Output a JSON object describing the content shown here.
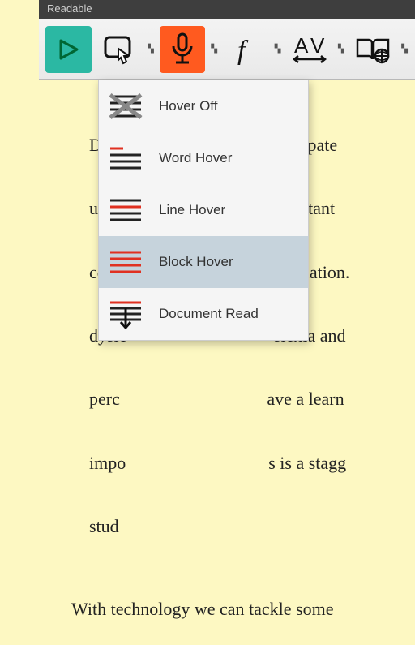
{
  "titlebar": {
    "title": "Readable"
  },
  "toolbar": {
    "buttons": [
      "play",
      "hover",
      "mic",
      "font",
      "spacing",
      "dictionary"
    ]
  },
  "dropdown": {
    "items": [
      {
        "label": "Hover Off",
        "icon": "lines-crossed"
      },
      {
        "label": "Word Hover",
        "icon": "lines-top-red"
      },
      {
        "label": "Line Hover",
        "icon": "lines-mid-red"
      },
      {
        "label": "Block Hover",
        "icon": "lines-all-red",
        "selected": true
      },
      {
        "label": "Document Read",
        "icon": "lines-arrow-down"
      }
    ]
  },
  "document": {
    "p1_l1": "Davi                                 articipate",
    "p1_l2": "unde                                  resistant",
    "p1_l3": "comp                                 education.",
    "p1_l4": "dysle                                 slexia and",
    "p1_l5": "perc                                 ave a learn",
    "p1_l6": "impo                                s is a stagg",
    "p1_l7": "stud",
    "p2": "With technology we can tackle some"
  }
}
